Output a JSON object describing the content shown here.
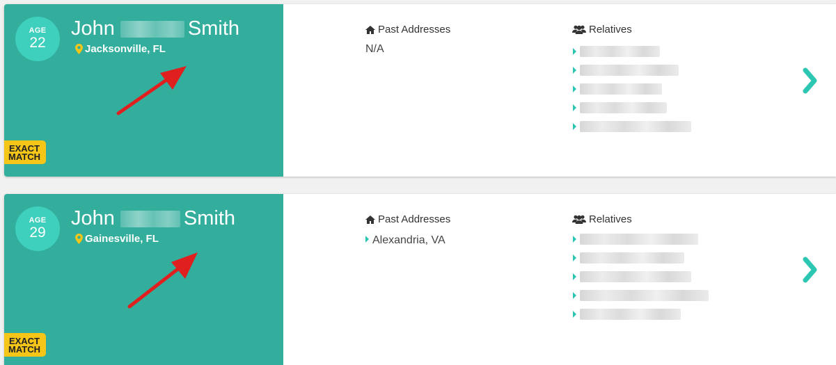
{
  "results": [
    {
      "age_label": "AGE",
      "age": "22",
      "first_name": "John",
      "last_name": "Smith",
      "location": "Jacksonville, FL",
      "badge": [
        "EXACT",
        "MATCH"
      ],
      "past_addresses_label": "Past Addresses",
      "past_addresses": "N/A",
      "relatives_label": "Relatives"
    },
    {
      "age_label": "AGE",
      "age": "29",
      "first_name": "John",
      "last_name": "Smith",
      "location": "Gainesville, FL",
      "badge": [
        "EXACT",
        "MATCH"
      ],
      "past_addresses_label": "Past Addresses",
      "past_addresses": "Alexandria, VA",
      "relatives_label": "Relatives"
    }
  ],
  "colors": {
    "panel": "#33ae9c",
    "age_circle": "#3ed0bd",
    "badge": "#f5c518",
    "accent": "#2dc6b2",
    "arrow": "#e01f1f",
    "pin": "#f5c518"
  },
  "icons": {
    "location": "map-pin-icon",
    "past_addresses": "home-icon",
    "relatives": "users-icon",
    "item_marker": "caret-right-icon",
    "open": "chevron-right-icon",
    "annotation": "red-arrow"
  }
}
